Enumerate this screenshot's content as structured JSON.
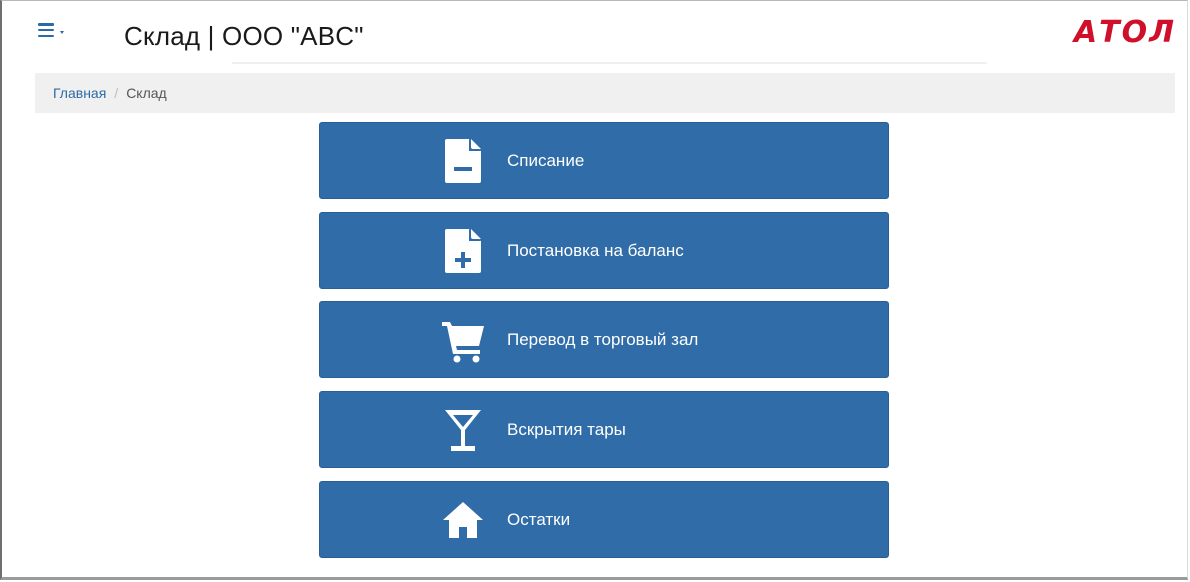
{
  "header": {
    "title": "Склад | ООО \"ABC\"",
    "logo": "АТОЛ",
    "menu_icon": "hamburger-menu-icon",
    "brand_color": "#d0102a"
  },
  "breadcrumb": {
    "items": [
      {
        "label": "Главная",
        "link": true
      },
      {
        "label": "Склад",
        "link": false
      }
    ],
    "separator": "/"
  },
  "tiles": [
    {
      "label": "Списание",
      "icon": "document-minus-icon"
    },
    {
      "label": "Постановка на баланс",
      "icon": "document-plus-icon"
    },
    {
      "label": "Перевод в торговый зал",
      "icon": "shopping-cart-icon"
    },
    {
      "label": "Вскрытия тары",
      "icon": "cocktail-glass-icon"
    },
    {
      "label": "Остатки",
      "icon": "home-icon"
    }
  ],
  "colors": {
    "tile_bg": "#2f6ca8",
    "link": "#2c6aa6",
    "breadcrumb_bg": "#f0f0f0"
  }
}
